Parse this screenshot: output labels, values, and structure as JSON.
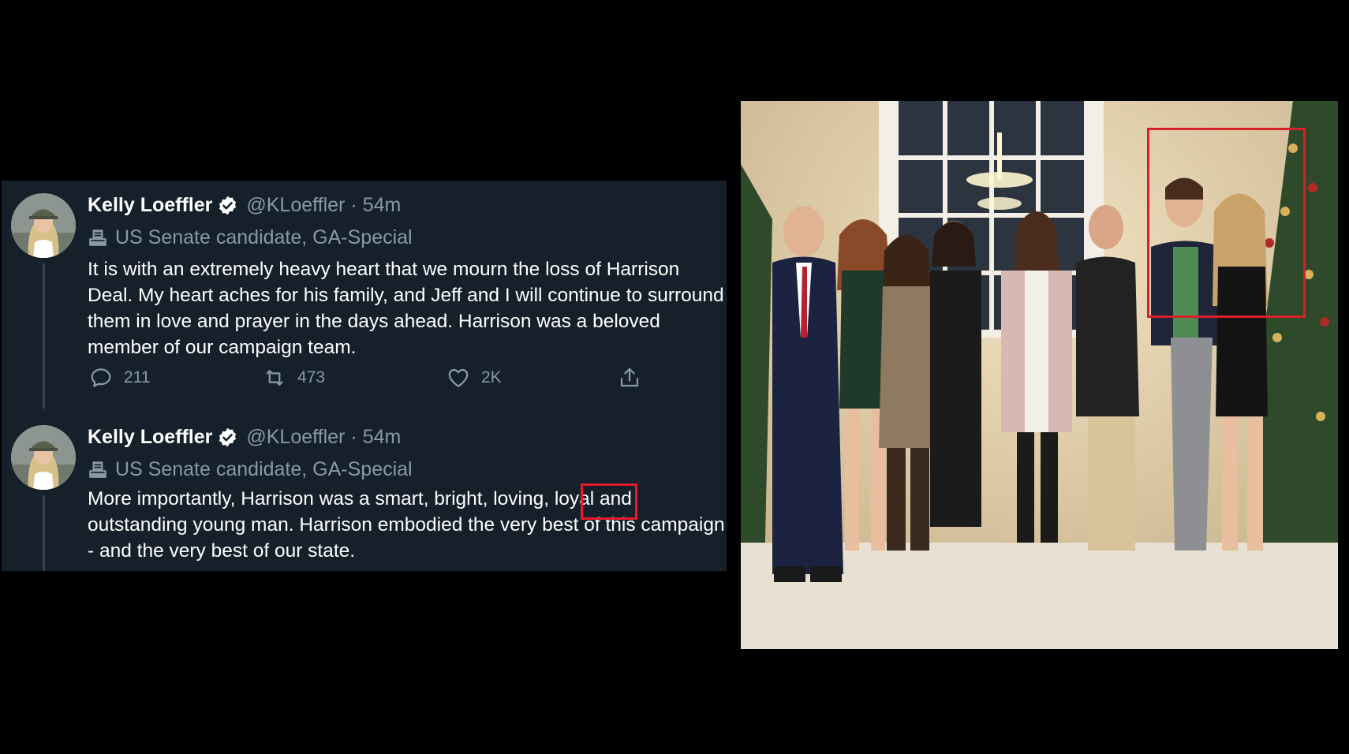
{
  "colors": {
    "background": "#000000",
    "tweet_panel": "#15202b",
    "text_primary": "#ffffff",
    "text_secondary": "#8899a6",
    "verified": "#ffffff",
    "annotation_red": "#e8192c"
  },
  "tweets": [
    {
      "display_name": "Kelly Loeffler",
      "verified": true,
      "handle": "@KLoeffler",
      "separator": "·",
      "time": "54m",
      "bio": "US Senate candidate, GA-Special",
      "text": "It is with an extremely heavy heart that we mourn the loss of Harrison Deal. My heart aches for his family, and Jeff and I will continue to surround them in love and prayer in the days ahead. Harrison was a beloved member of our campaign team.",
      "actions": {
        "replies": "211",
        "retweets": "473",
        "likes": "2K"
      }
    },
    {
      "display_name": "Kelly Loeffler",
      "verified": true,
      "handle": "@KLoeffler",
      "separator": "·",
      "time": "54m",
      "bio": "US Senate candidate, GA-Special",
      "text": "More importantly, Harrison was a smart, bright, loving, loyal and outstanding young man. Harrison embodied the very best of this campaign - and the very best of our state."
    }
  ],
  "icons": {
    "reply": "reply-icon",
    "retweet": "retweet-icon",
    "like": "heart-icon",
    "share": "share-icon",
    "verified": "verified-badge-icon",
    "bio": "ballot-box-icon"
  }
}
